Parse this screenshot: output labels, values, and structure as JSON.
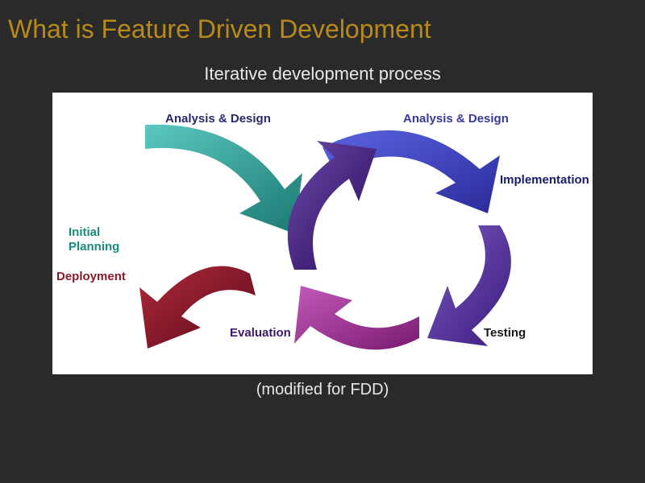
{
  "title": "What is Feature Driven Development",
  "subtitle": "Iterative development process",
  "caption": "(modified for FDD)",
  "diagram": {
    "labels": {
      "analysis_design_left": "Analysis & Design",
      "analysis_design_right": "Analysis & Design",
      "implementation": "Implementation",
      "initial_planning": "Initial\nPlanning",
      "deployment": "Deployment",
      "evaluation": "Evaluation",
      "testing": "Testing"
    },
    "colors": {
      "teal": "#3aa6a0",
      "blue": "#3a44c4",
      "purple": "#5a3aa0",
      "magenta": "#a03a9a",
      "dark_purple": "#4a2a8a",
      "maroon": "#8a1a2a"
    },
    "cycle_order": [
      "Analysis & Design",
      "Implementation",
      "Testing",
      "Evaluation"
    ],
    "entry": "Initial Planning",
    "exit": "Deployment"
  }
}
